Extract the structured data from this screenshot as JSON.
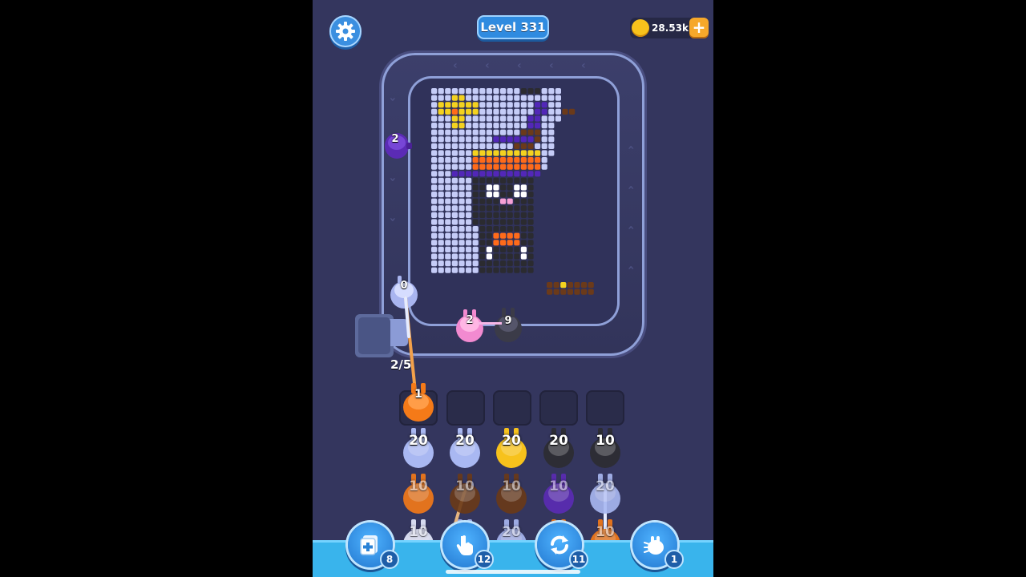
{
  "header": {
    "level_label": "Level 331",
    "coins": "28.53k",
    "add_coins_label": "+"
  },
  "track": {
    "conveyor_creatures": [
      {
        "color": "#5b2bb5",
        "count": "2"
      },
      {
        "color": "#f28ad0",
        "count": "2"
      },
      {
        "color": "#3b3b48",
        "count": "9"
      }
    ],
    "shooter": {
      "color": "#a9b5f0",
      "count": "0"
    },
    "queue_progress": "2/5"
  },
  "slots": {
    "active": {
      "color": "#f57a18",
      "count": "1"
    },
    "empty_count": 4
  },
  "grid": {
    "rows": [
      [
        {
          "color": "#a9b8f2",
          "count": "20"
        },
        {
          "color": "#a9b8f2",
          "count": "20"
        },
        {
          "color": "#f7c21c",
          "count": "20"
        },
        {
          "color": "#2d2d35",
          "count": "20"
        },
        {
          "color": "#2d2d35",
          "count": "10"
        }
      ],
      [
        {
          "color": "#f57a18",
          "count": "10"
        },
        {
          "color": "#6b3a18",
          "count": "10"
        },
        {
          "color": "#6b3a18",
          "count": "10"
        },
        {
          "color": "#5b2bb5",
          "count": "10"
        },
        {
          "color": "#a9b8f2",
          "count": "20"
        }
      ],
      [
        {
          "color": "#e8ecff",
          "count": "10"
        },
        {
          "color": "#a9b8f2",
          "count": ""
        },
        {
          "color": "#a9b8f2",
          "count": "20"
        },
        {
          "color": "#f57a18",
          "count": ""
        },
        {
          "color": "#f57a18",
          "count": "10"
        }
      ]
    ]
  },
  "boosters": [
    {
      "icon": "add-slot-icon",
      "count": "8"
    },
    {
      "icon": "hand-icon",
      "count": "12"
    },
    {
      "icon": "shuffle-icon",
      "count": "11"
    },
    {
      "icon": "magnet-icon",
      "count": "1"
    }
  ],
  "colors": {
    "background": "#34365e",
    "track": "#8fa0d8",
    "accent": "#2f8be0",
    "bottom_bar": "#39b4ec"
  }
}
